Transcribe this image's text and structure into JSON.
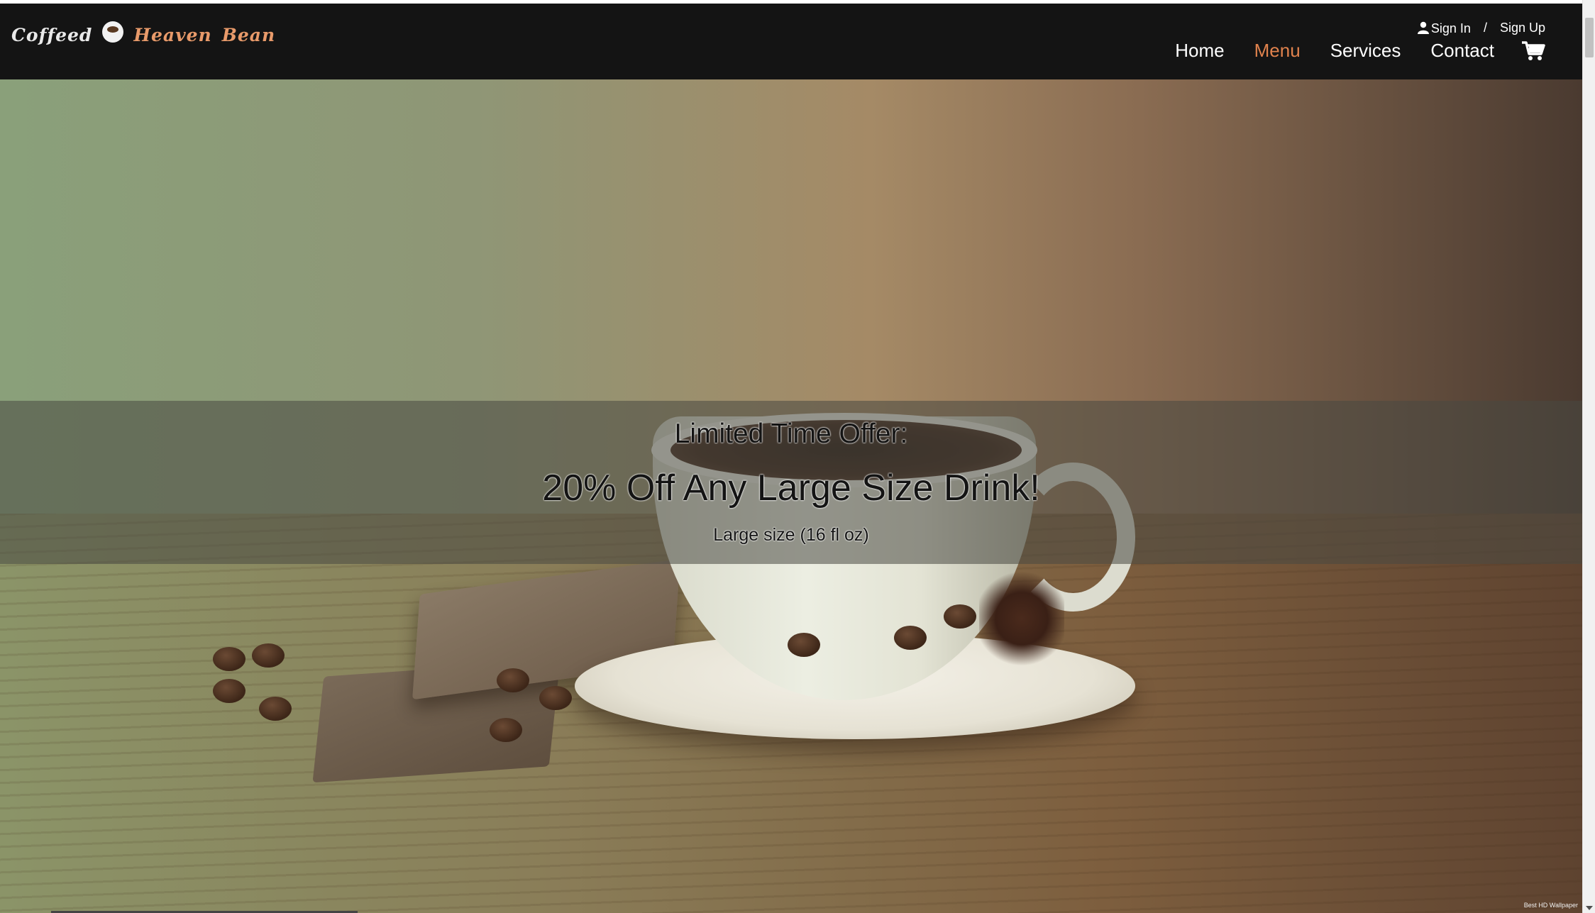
{
  "brand": {
    "word1": "Coffeed",
    "word2": "Heaven",
    "word3": "Bean"
  },
  "auth": {
    "sign_in": "Sign In",
    "separator": "/",
    "sign_up": "Sign Up"
  },
  "nav": {
    "items": [
      {
        "label": "Home",
        "active": false
      },
      {
        "label": "Menu",
        "active": true
      },
      {
        "label": "Services",
        "active": false
      },
      {
        "label": "Contact",
        "active": false
      }
    ],
    "cart_icon": "cart-icon"
  },
  "hero": {
    "offer_title": "Limited Time Offer:",
    "offer_headline": "20% Off Any Large Size Drink!",
    "offer_note": "Large size (16 fl oz)",
    "credit": "Best HD Wallpaper"
  },
  "colors": {
    "navbar_bg": "#141414",
    "active_nav": "#e0824d",
    "brand_accent": "#e89a6a"
  }
}
